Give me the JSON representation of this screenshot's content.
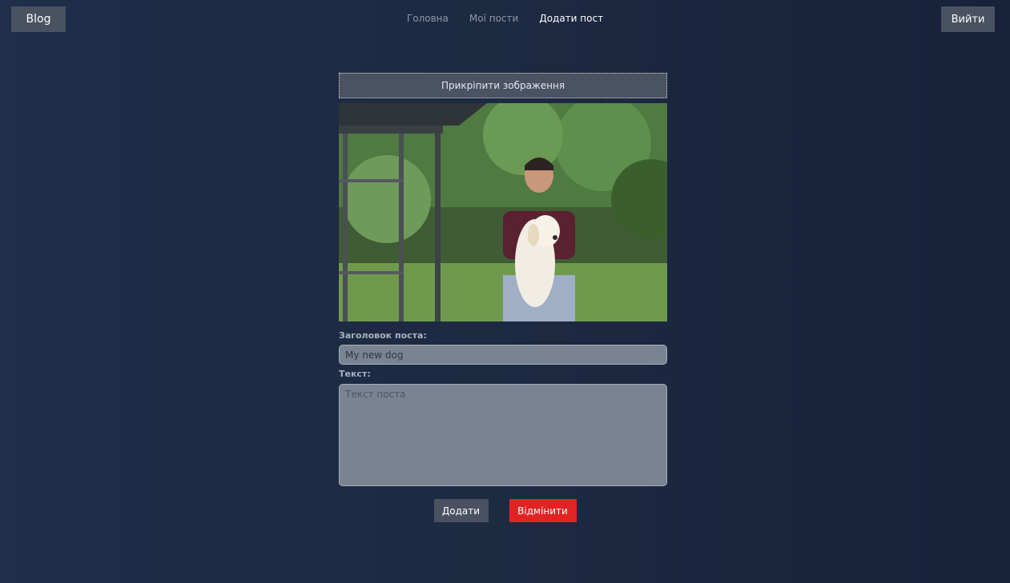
{
  "header": {
    "logo_label": "Blog",
    "nav": [
      {
        "label": "Головна",
        "active": false
      },
      {
        "label": "Мої пости",
        "active": false
      },
      {
        "label": "Додати пост",
        "active": true
      }
    ],
    "logout_label": "Вийти"
  },
  "form": {
    "attach_label": "Прикріпити зображення",
    "title_label": "Заголовок поста:",
    "title_value": "My new dog",
    "text_label": "Текст:",
    "text_placeholder": "Текст поста",
    "add_label": "Додати",
    "cancel_label": "Відмінити"
  },
  "colors": {
    "accent_danger": "#e02424",
    "button_gray": "#4a5261",
    "background": "#1f2e49"
  }
}
